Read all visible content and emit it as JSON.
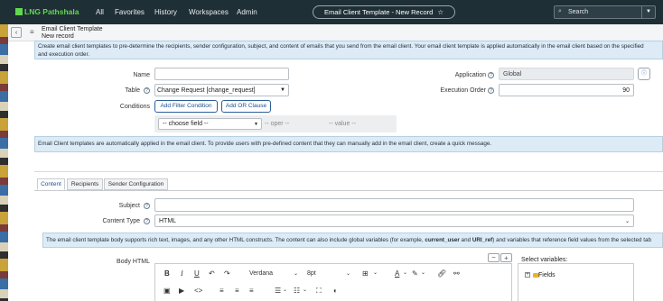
{
  "nav": {
    "logo_text": "LNG Pathshala",
    "items": [
      "All",
      "Favorites",
      "History",
      "Workspaces",
      "Admin"
    ],
    "record_pill": "Email Client Template - New Record",
    "search_placeholder": "Search"
  },
  "header": {
    "title": "Email Client Template",
    "subtitle": "New record"
  },
  "info1": "Create email client templates to pre-determine the recipients, sender configuration, subject, and content of emails that you send from the email client. Your email client template is applied automatically in the email client based on the specified",
  "info1b": "and execution order.",
  "form": {
    "name_label": "Name",
    "name_value": "",
    "table_label": "Table",
    "table_value": "Change Request [change_request]",
    "conditions_label": "Conditions",
    "add_filter": "Add Filter Condition",
    "add_or": "Add OR Clause",
    "choose_field": "-- choose field --",
    "oper": "-- oper --",
    "value": "-- value --",
    "application_label": "Application",
    "application_value": "Global",
    "exec_order_label": "Execution Order",
    "exec_order_value": "90"
  },
  "info2": "Email Client templates are automatically applied in the email client. To provide users with pre-defined content that they can manually add in the email client, create a quick message.",
  "tabs": [
    "Content",
    "Recipients",
    "Sender Configuration"
  ],
  "content": {
    "subject_label": "Subject",
    "subject_value": "",
    "content_type_label": "Content Type",
    "content_type_value": "HTML",
    "info3a": "The email client template body supports rich text, images, and any other HTML constructs. The content can also include global variables (for example, ",
    "info3_b1": "current_user",
    "info3c": " and ",
    "info3_b2": "URI_ref",
    "info3d": ") and variables that reference field values from the selected tab",
    "body_label": "Body HTML",
    "font_name": "Verdana",
    "font_size": "8pt",
    "select_variables": "Select variables:",
    "fields_node": "Fields"
  }
}
